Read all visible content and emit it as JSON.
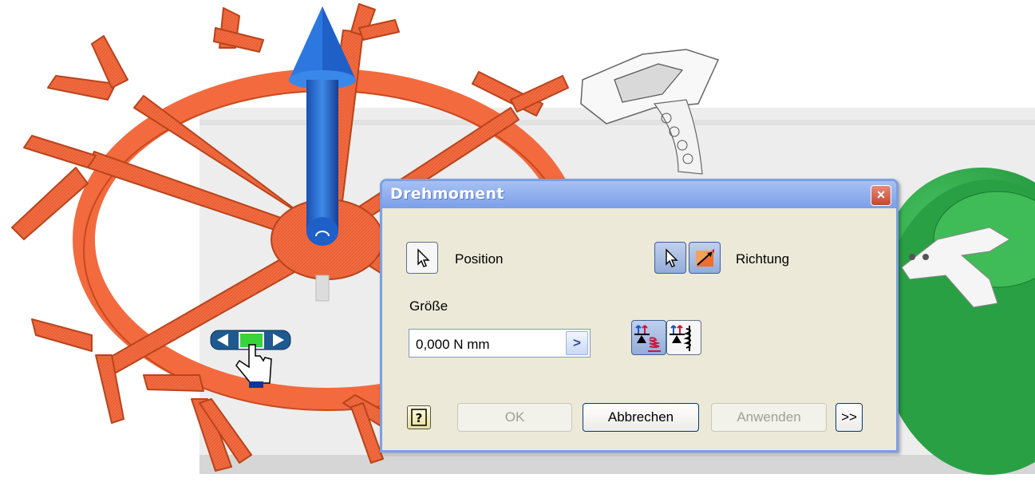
{
  "dialog": {
    "title": "Drehmoment",
    "close_label": "×",
    "position_label": "Position",
    "richtung_label": "Richtung",
    "groesse_label": "Größe",
    "value": "0,000 N mm",
    "value_arrow": ">",
    "help_label": "?",
    "ok_label": "OK",
    "cancel_label": "Abbrechen",
    "apply_label": "Anwenden",
    "more_label": ">>"
  },
  "icons": {
    "position_select": "cursor-arrow-icon",
    "direction_select": "cursor-arrow-icon",
    "flip_direction": "flip-direction-icon",
    "torque_mode_1": "torque-spring-icon",
    "torque_mode_2": "torque-coil-icon",
    "help": "help-question-icon",
    "move_triad": "move-arrows-icon",
    "hand_cursor": "hand-cursor-icon"
  },
  "colors": {
    "gear": "#f2673a",
    "gear_edge": "#c8491f",
    "arrow": "#1f6bd6",
    "green_part": "#2fa84a",
    "titlebar": "#7b9fe8",
    "dialog_bg": "#ece9d8"
  }
}
